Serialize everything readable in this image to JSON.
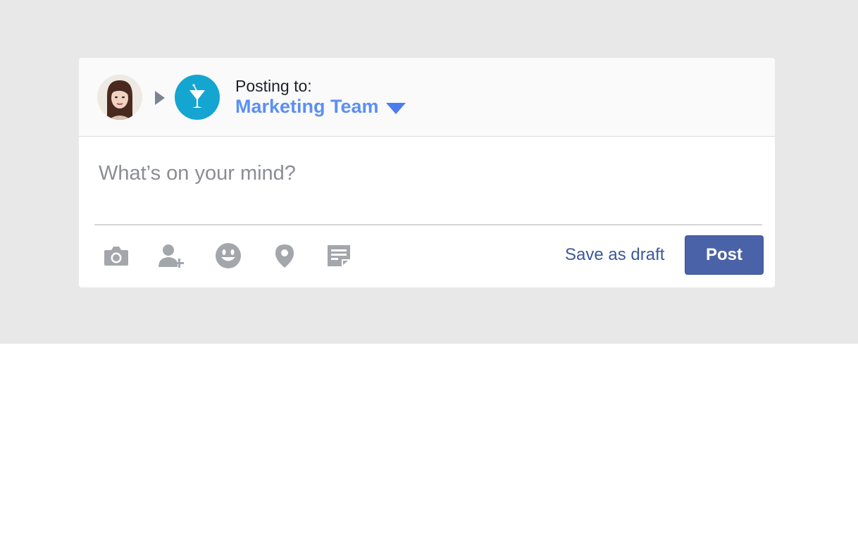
{
  "composer": {
    "posting_label": "Posting to:",
    "audience_name": "Marketing Team",
    "placeholder": "What’s on your mind?",
    "draft_label": "Save as draft",
    "post_label": "Post"
  },
  "toolbar": {
    "tools": [
      {
        "name": "camera-icon",
        "title": "Photo"
      },
      {
        "name": "tag-people-icon",
        "title": "Tag people"
      },
      {
        "name": "emoji-icon",
        "title": "Feeling"
      },
      {
        "name": "location-icon",
        "title": "Location"
      },
      {
        "name": "note-icon",
        "title": "Note"
      }
    ]
  },
  "colors": {
    "accent": "#5b8ff3",
    "group_icon": "#14a5d1",
    "post_button": "#4a62a8",
    "link": "#3b5998",
    "icon_gray": "#a3a6ab"
  }
}
